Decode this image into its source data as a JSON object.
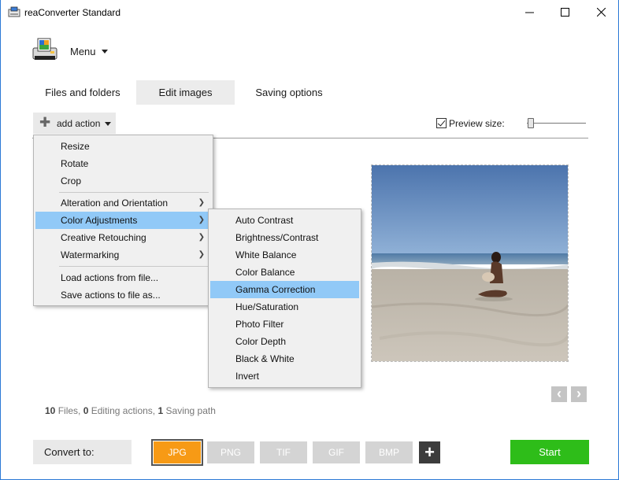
{
  "window": {
    "title": "reaConverter Standard",
    "controls": {
      "minimize": "—",
      "maximize": "☐",
      "close": "✕"
    }
  },
  "menu": {
    "label": "Menu"
  },
  "tabs": [
    {
      "label": "Files and folders",
      "active": false
    },
    {
      "label": "Edit images",
      "active": true
    },
    {
      "label": "Saving options",
      "active": false
    }
  ],
  "toolbar": {
    "add_action_label": "add action",
    "preview_label": "Preview size:",
    "preview_checked": true,
    "preview_size_level": 0.03
  },
  "action_menu": {
    "items": [
      {
        "label": "Resize"
      },
      {
        "label": "Rotate"
      },
      {
        "label": "Crop"
      },
      {
        "label": "Alteration and Orientation",
        "submenu": true
      },
      {
        "label": "Color Adjustments",
        "submenu": true,
        "highlighted": true
      },
      {
        "label": "Creative Retouching",
        "submenu": true
      },
      {
        "label": "Watermarking",
        "submenu": true
      },
      {
        "label": "Load actions from file..."
      },
      {
        "label": "Save actions to file as..."
      }
    ]
  },
  "color_submenu": {
    "items": [
      {
        "label": "Auto Contrast"
      },
      {
        "label": "Brightness/Contrast"
      },
      {
        "label": "White Balance"
      },
      {
        "label": "Color Balance"
      },
      {
        "label": "Gamma Correction",
        "highlighted": true
      },
      {
        "label": "Hue/Saturation"
      },
      {
        "label": "Photo Filter"
      },
      {
        "label": "Color Depth"
      },
      {
        "label": "Black & White"
      },
      {
        "label": "Invert"
      }
    ]
  },
  "status": {
    "files_count": "10",
    "files_label": "Files,",
    "editing_count": "0",
    "editing_label": "Editing actions,",
    "saving_count": "1",
    "saving_label": "Saving path"
  },
  "convert": {
    "label": "Convert to:",
    "formats": [
      "JPG",
      "PNG",
      "TIF",
      "GIF",
      "BMP"
    ],
    "selected": "JPG",
    "add_label": "+"
  },
  "start_label": "Start",
  "colors": {
    "selected_format": "#f79a15",
    "start_button": "#2ebd19",
    "menu_highlight": "#91c9f7"
  }
}
